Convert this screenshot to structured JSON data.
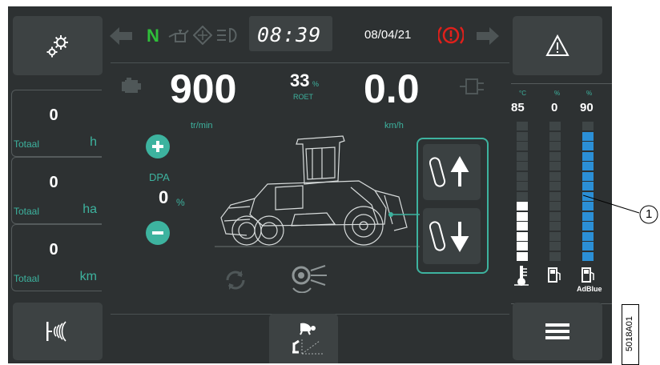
{
  "status_bar": {
    "gear": "N",
    "time": "08:39",
    "date": "08/04/21",
    "colors": {
      "gear": "#2fbf3a",
      "warning_red": "#e0201b",
      "teal": "#3db39f"
    }
  },
  "gauges": {
    "engine_rpm": "900",
    "engine_unit": "tr/min",
    "soot_value": "33",
    "soot_percent": "%",
    "soot_label": "ROET",
    "speed": "0.0",
    "speed_unit": "km/h"
  },
  "dpa": {
    "label": "DPA",
    "value": "0",
    "percent": "%"
  },
  "counters": [
    {
      "value": "0",
      "label": "Totaal",
      "unit": "h"
    },
    {
      "value": "0",
      "label": "Totaal",
      "unit": "ha"
    },
    {
      "value": "0",
      "label": "Totaal",
      "unit": "km"
    }
  ],
  "levels": {
    "coolant": {
      "unit": "°C",
      "value": "85",
      "filled_segments": 6,
      "total_segments": 14,
      "icon": "coolant-temperature-icon"
    },
    "fuel": {
      "unit": "%",
      "value": "0",
      "filled_segments": 0,
      "total_segments": 14,
      "icon": "fuel-pump-icon"
    },
    "adblue": {
      "unit": "%",
      "value": "90",
      "filled_segments": 13,
      "total_segments": 14,
      "label": "AdBlue",
      "icon": "adblue-pump-icon",
      "color": "#2b8fd6"
    }
  },
  "callout": "1",
  "figure_code": "5018A01",
  "icons": {
    "settings": "gear-settings-icon",
    "warning": "warning-triangle-icon",
    "menu": "hamburger-menu-icon",
    "radar": "ground-sensor-icon",
    "turtle": "turtle-speed-icon"
  }
}
